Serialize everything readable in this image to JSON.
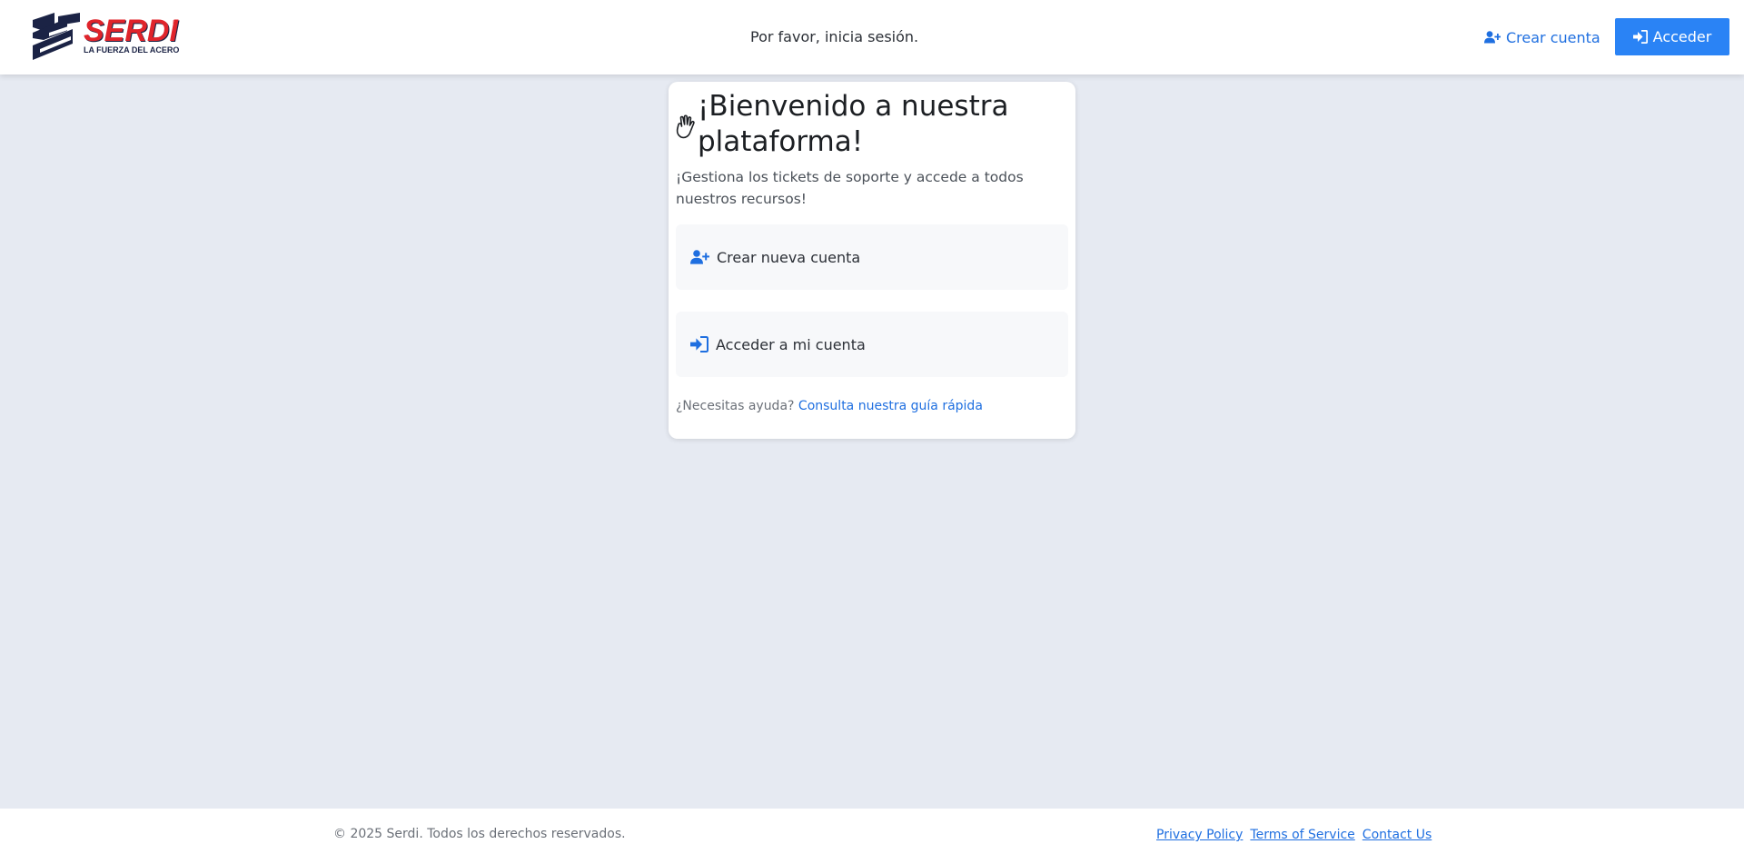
{
  "header": {
    "logo": {
      "brand": "SERDI",
      "registered": "®",
      "tagline": "LA FUERZA DEL ACERO"
    },
    "message": "Por favor, inicia sesión.",
    "signup_label": "Crear cuenta",
    "login_label": "Acceder"
  },
  "card": {
    "title": "¡Bienvenido a nuestra plataforma!",
    "subtitle": "¡Gestiona los tickets de soporte y accede a todos nuestros recursos!",
    "options": [
      {
        "label": "Crear nueva cuenta",
        "icon": "user-plus-icon"
      },
      {
        "label": "Acceder a mi cuenta",
        "icon": "sign-in-icon"
      }
    ],
    "help_text": "¿Necesitas ayuda?",
    "help_link": "Consulta nuestra guía rápida"
  },
  "footer": {
    "copyright": "© 2025 Serdi. Todos los derechos reservados.",
    "links": [
      "Privacy Policy",
      "Terms of Service",
      "Contact Us"
    ]
  },
  "colors": {
    "accent": "#2a83f5",
    "link": "#1f6fe0",
    "brand_red": "#e0242b",
    "brand_navy": "#1b2345",
    "background": "#e6eaf2"
  }
}
